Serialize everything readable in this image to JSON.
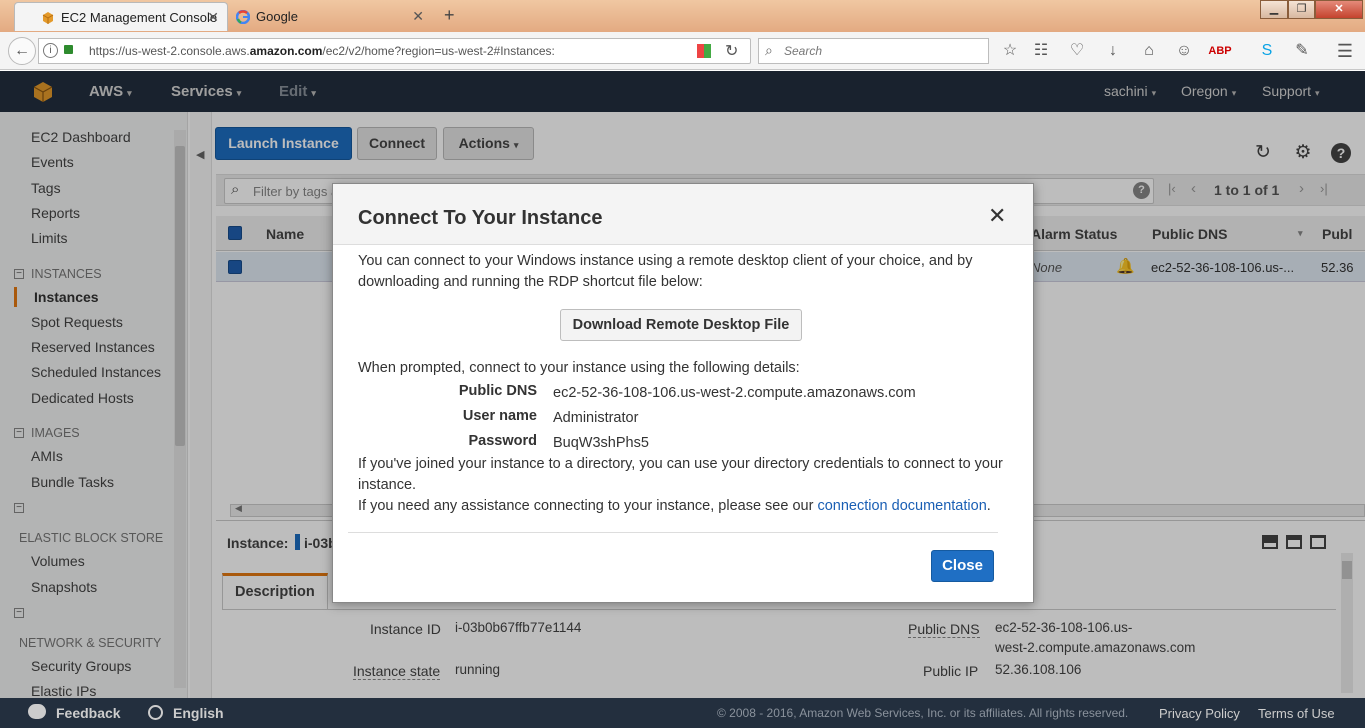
{
  "browser": {
    "tabs": [
      {
        "title": "EC2 Management Console",
        "close": "✕"
      },
      {
        "title": "Google",
        "close": "✕"
      }
    ],
    "new_tab": "+",
    "url_parts": [
      "https://us-west-2.console.aws.",
      "amazon.com",
      "/ec2/v2/home?region=us-west-2#Instances:"
    ],
    "search_placeholder": "Search",
    "window_buttons": {
      "minimize": "▁",
      "maximize": "❐",
      "close": "✕"
    }
  },
  "aws_header": {
    "aws_label": "AWS",
    "services_label": "Services",
    "edit_label": "Edit",
    "user": "sachini",
    "region": "Oregon",
    "support": "Support"
  },
  "sidebar": {
    "top_items": [
      "EC2 Dashboard",
      "Events",
      "Tags",
      "Reports",
      "Limits"
    ],
    "instances_section": "INSTANCES",
    "instances_items": [
      "Instances",
      "Spot Requests",
      "Reserved Instances",
      "Scheduled Instances",
      "Dedicated Hosts"
    ],
    "images_section": "IMAGES",
    "images_items": [
      "AMIs",
      "Bundle Tasks"
    ],
    "ebs_section": "ELASTIC BLOCK STORE",
    "ebs_items": [
      "Volumes",
      "Snapshots"
    ],
    "network_section": "NETWORK & SECURITY",
    "network_items": [
      "Security Groups",
      "Elastic IPs"
    ],
    "collapse_glyph": "−"
  },
  "toolbar": {
    "launch": "Launch Instance",
    "connect": "Connect",
    "actions": "Actions"
  },
  "filter": {
    "placeholder": "Filter by tags and attributes or search by keyword",
    "pagination": "1 to 1 of 1"
  },
  "table": {
    "headers": {
      "name": "Name",
      "alarm": "Alarm Status",
      "dns": "Public DNS",
      "ip": "Publ"
    },
    "row": {
      "alarm": "None",
      "dns": "ec2-52-36-108-106.us-...",
      "ip": "52.36"
    }
  },
  "detail": {
    "instance_label": "Instance:",
    "instance_value": "i-03b",
    "tab": "Description",
    "instance_id_label": "Instance ID",
    "instance_id": "i-03b0b67ffb77e1144",
    "state_label": "Instance state",
    "state": "running",
    "public_dns_label": "Public DNS",
    "public_dns_line1": "ec2-52-36-108-106.us-",
    "public_dns_line2": "west-2.compute.amazonaws.com",
    "public_ip_label": "Public IP",
    "public_ip": "52.36.108.106"
  },
  "modal": {
    "title": "Connect To Your Instance",
    "close_x": "✕",
    "intro_line1": "You can connect to your Windows instance using a remote desktop client of your choice, and by",
    "intro_line2": "downloading and running the RDP shortcut file below:",
    "download_button": "Download Remote Desktop File",
    "prompt": "When prompted, connect to your instance using the following details:",
    "public_dns_label": "Public DNS",
    "public_dns": "ec2-52-36-108-106.us-west-2.compute.amazonaws.com",
    "username_label": "User name",
    "username": "Administrator",
    "password_label": "Password",
    "password": "BuqW3shPhs5",
    "directory_line1": "If you've joined your instance to a directory, you can use your directory credentials to connect to your",
    "directory_line2": "instance.",
    "assist_text": "If you need any assistance connecting to your instance, please see our",
    "assist_link": "connection documentation",
    "assist_end": ".",
    "close_button": "Close"
  },
  "footer": {
    "feedback": "Feedback",
    "language": "English",
    "copyright": "© 2008 - 2016, Amazon Web Services, Inc. or its affiliates. All rights reserved.",
    "privacy": "Privacy Policy",
    "terms": "Terms of Use"
  },
  "colors": {
    "aws_header": "#232f3e",
    "primary_button": "#1d6ec2",
    "link": "#1a5fb4"
  }
}
